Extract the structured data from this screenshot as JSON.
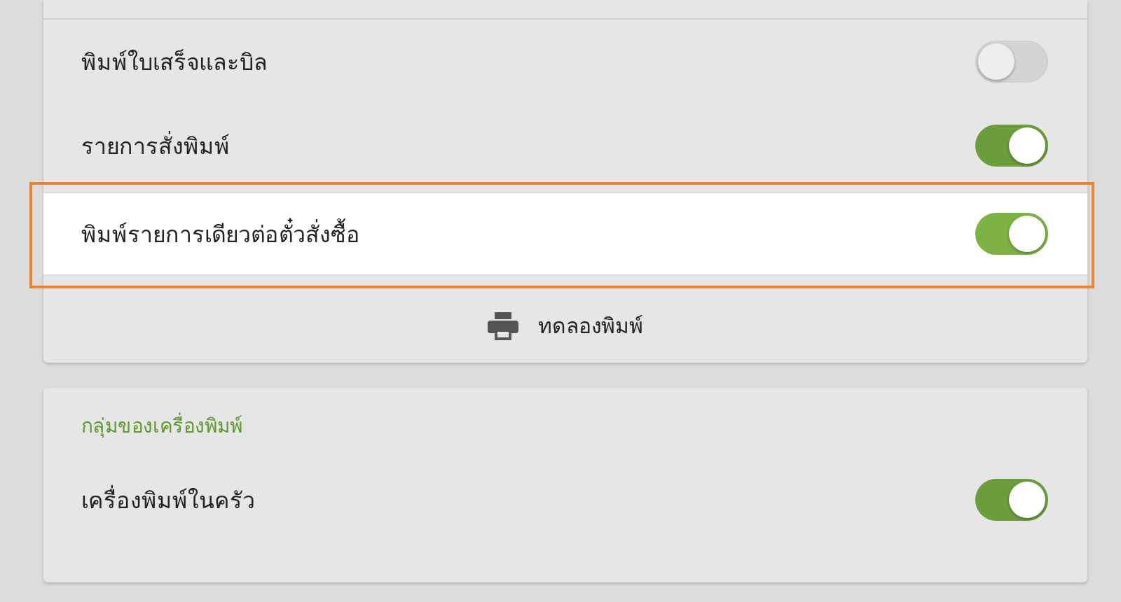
{
  "print_settings": {
    "rows": [
      {
        "label": "พิมพ์ใบเสร็จและบิล",
        "on": false,
        "highlighted": false
      },
      {
        "label": "รายการสั่งพิมพ์",
        "on": true,
        "highlighted": false
      },
      {
        "label": "พิมพ์รายการเดียวต่อตั๋วสั่งซื้อ",
        "on": true,
        "highlighted": true
      }
    ],
    "test_print_button": "ทดลองพิมพ์"
  },
  "printer_group": {
    "title": "กลุ่มของเครื่องพิมพ์",
    "rows": [
      {
        "label": "เครื่องพิมพ์ในครัว",
        "on": true,
        "highlighted": false
      }
    ]
  }
}
